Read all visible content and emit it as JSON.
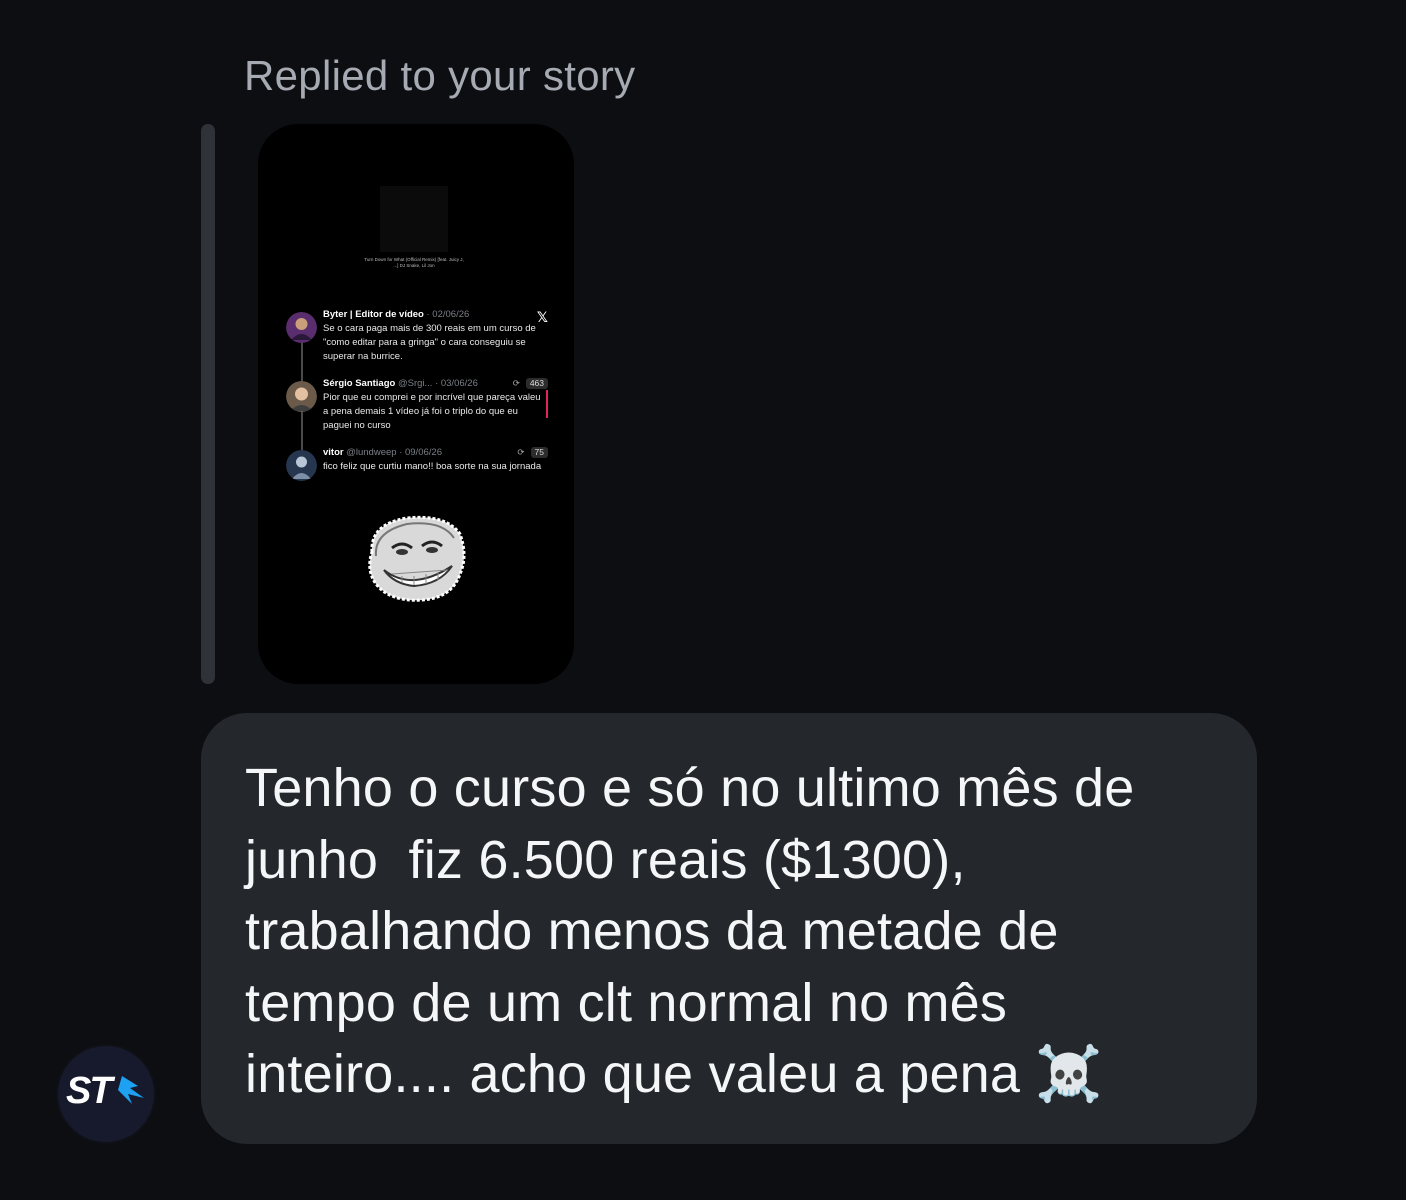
{
  "reply_header": "Replied to your story",
  "story": {
    "music_caption": "Turn Down for What (Official Remix) [feat. Juicy J, ...] DJ Snake, Lil Jon",
    "tweets": [
      {
        "name": "Byter | Editor de vídeo",
        "meta": "· 02/06/26",
        "text": "Se o cara paga mais de 300 reais em um curso de \"como editar para a gringa\" o cara conseguiu se superar na burrice."
      },
      {
        "name": "Sérgio Santiago",
        "meta": "@Srgi... · 03/06/26",
        "stat": "463",
        "text": "Pior que eu comprei e por incrível que pareça valeu a pena demais 1 vídeo já foi o triplo do que eu paguei no curso"
      },
      {
        "name": "vitor",
        "meta": "@lundweep · 09/06/26",
        "stat": "75",
        "text": "fico feliz que curtiu mano!! boa sorte na sua jornada"
      }
    ]
  },
  "message": {
    "text": "Tenho o curso e só no ultimo mês de\njunho  fiz 6.500 reais ($1300),\ntrabalhando menos da metade de\ntempo de um clt normal no mês\ninteiro.... acho que valeu a pena ☠️"
  },
  "avatar": {
    "logo_text": "ST",
    "accent_color": "#1da1f2",
    "bg_color": "#171a2c"
  },
  "colors": {
    "background": "#0c0e11",
    "bubble": "#24272c",
    "header_text": "#a6abb3"
  }
}
